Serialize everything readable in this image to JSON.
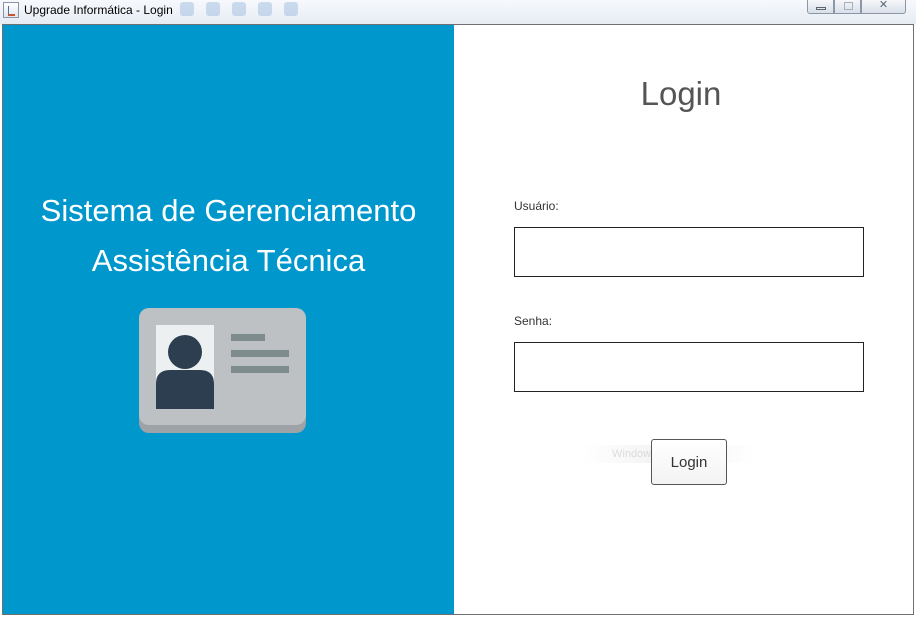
{
  "window": {
    "title": "Upgrade Informática - Login",
    "controls": {
      "minimize_icon": "minimize-icon",
      "maximize_icon": "maximize-icon",
      "close_icon": "close-icon"
    }
  },
  "brand_panel": {
    "background_color": "#0097cc",
    "title_line_1": "Sistema de Gerenciamento",
    "title_line_2": "Assistência Técnica",
    "illustration_icon": "id-card-icon"
  },
  "login_form": {
    "heading": "Login",
    "username": {
      "label": "Usuário:",
      "value": "",
      "placeholder": ""
    },
    "password": {
      "label": "Senha:",
      "value": "",
      "placeholder": ""
    },
    "submit_label": "Login"
  },
  "overlay": {
    "watermark_text": "Windows"
  }
}
